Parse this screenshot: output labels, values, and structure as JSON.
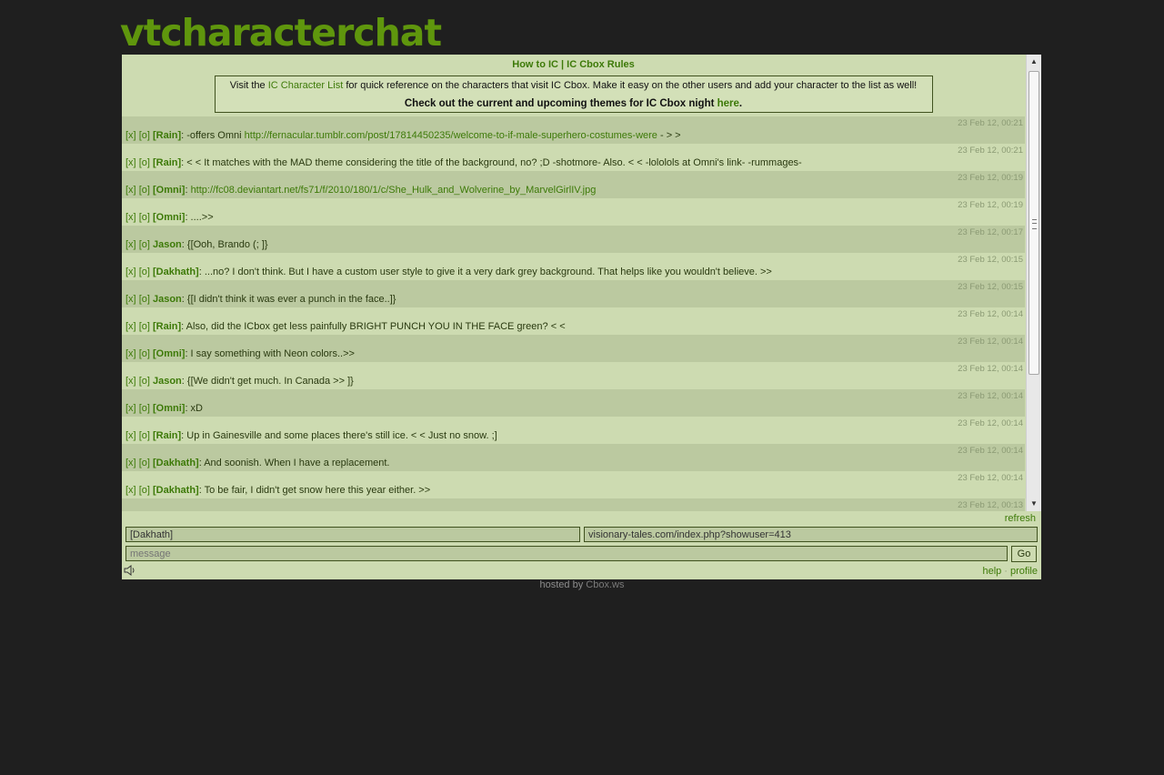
{
  "site": {
    "title": "vtcharacterchat"
  },
  "header": {
    "how_to": "How to IC",
    "sep": " | ",
    "rules": "IC Cbox Rules"
  },
  "notice": {
    "line1_pre": "Visit the ",
    "line1_link": "IC Character List",
    "line1_post": " for quick reference on the characters that visit IC Cbox. Make it easy on the other users and add your character to the list as well!",
    "line2_pre": "Check out the current and upcoming themes for IC Cbox night ",
    "line2_link": "here",
    "line2_post": "."
  },
  "controls": {
    "delete": "[x]",
    "ip": "[o]"
  },
  "messages": [
    {
      "ts": "23 Feb 12, 00:21",
      "name": "[Rain]",
      "text": ": -offers Omni ",
      "link": "http://fernacular.tumblr.com/post/17814450235/welcome-to-if-male-superhero-costumes-were",
      "after": " - > >"
    },
    {
      "ts": "23 Feb 12, 00:21",
      "name": "[Rain]",
      "text": ": < < It matches with the MAD theme considering the title of the background, no? ;D -shotmore- Also. < < -lololols at Omni's link- -rummages-",
      "link": "",
      "after": ""
    },
    {
      "ts": "23 Feb 12, 00:19",
      "name": "[Omni]",
      "text": ": ",
      "link": "http://fc08.deviantart.net/fs71/f/2010/180/1/c/She_Hulk_and_Wolverine_by_MarvelGirlIV.jpg",
      "after": ""
    },
    {
      "ts": "23 Feb 12, 00:19",
      "name": "[Omni]",
      "text": ": ....>>",
      "link": "",
      "after": ""
    },
    {
      "ts": "23 Feb 12, 00:17",
      "name": "Jason",
      "text": ": {[Ooh, Brando (; ]}",
      "link": "",
      "after": ""
    },
    {
      "ts": "23 Feb 12, 00:15",
      "name": "[Dakhath]",
      "text": ": ...no? I don't think. But I have a custom user style to give it a very dark grey background. That helps like you wouldn't believe. >>",
      "link": "",
      "after": ""
    },
    {
      "ts": "23 Feb 12, 00:15",
      "name": "Jason",
      "text": ": {[I didn't think it was ever a punch in the face..]}",
      "link": "",
      "after": ""
    },
    {
      "ts": "23 Feb 12, 00:14",
      "name": "[Rain]",
      "text": ": Also, did the ICbox get less painfully BRIGHT PUNCH YOU IN THE FACE green? < <",
      "link": "",
      "after": ""
    },
    {
      "ts": "23 Feb 12, 00:14",
      "name": "[Omni]",
      "text": ": I say something with Neon colors..>>",
      "link": "",
      "after": ""
    },
    {
      "ts": "23 Feb 12, 00:14",
      "name": "Jason",
      "text": ": {[We didn't get much. In Canada >> ]}",
      "link": "",
      "after": ""
    },
    {
      "ts": "23 Feb 12, 00:14",
      "name": "[Omni]",
      "text": ": xD",
      "link": "",
      "after": ""
    },
    {
      "ts": "23 Feb 12, 00:14",
      "name": "[Rain]",
      "text": ": Up in Gainesville and some places there's still ice. < < Just no snow. ;]",
      "link": "",
      "after": ""
    },
    {
      "ts": "23 Feb 12, 00:14",
      "name": "[Dakhath]",
      "text": ": And soonish. When I have a replacement.",
      "link": "",
      "after": ""
    },
    {
      "ts": "23 Feb 12, 00:14",
      "name": "[Dakhath]",
      "text": ": To be fair, I didn't get snow here this year either. >>",
      "link": "",
      "after": ""
    },
    {
      "ts": "23 Feb 12, 00:13",
      "name": "",
      "text": "",
      "link": "",
      "after": ""
    }
  ],
  "form": {
    "refresh": "refresh",
    "name_value": "[Dakhath]",
    "url_value": "visionary-tales.com/index.php?showuser=413",
    "message_placeholder": "message",
    "go": "Go",
    "help": "help",
    "dot": " · ",
    "profile": "profile"
  },
  "footer": {
    "hosted": "hosted by ",
    "brand": "Cbox.ws"
  },
  "colors": {
    "page_bg": "#1f1f1f",
    "box_bg": "#cddbb1",
    "row_alt": "#bbc9a0",
    "accent": "#3d7a08",
    "title": "#5f960d"
  }
}
